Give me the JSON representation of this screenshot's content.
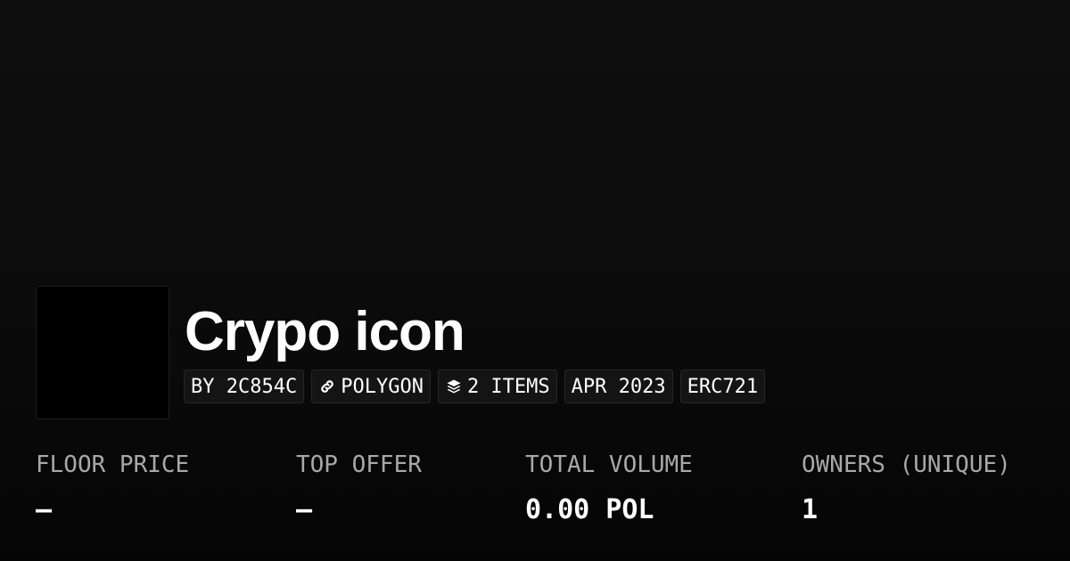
{
  "collection": {
    "title": "Crypo icon",
    "chips": [
      {
        "label": "BY 2C854C",
        "icon": null
      },
      {
        "label": "POLYGON",
        "icon": "link-icon"
      },
      {
        "label": "2 ITEMS",
        "icon": "layers-icon"
      },
      {
        "label": "APR 2023",
        "icon": null
      },
      {
        "label": "ERC721",
        "icon": null
      }
    ]
  },
  "stats": [
    {
      "label": "FLOOR PRICE",
      "value": "–"
    },
    {
      "label": "TOP OFFER",
      "value": "–"
    },
    {
      "label": "TOTAL VOLUME",
      "value": "0.00 POL"
    },
    {
      "label": "OWNERS (UNIQUE)",
      "value": "1"
    }
  ],
  "colors": {
    "background": "#0b0b0b",
    "text": "#ffffff",
    "muted": "#a8a8a8",
    "chip_bg": "#141414"
  }
}
